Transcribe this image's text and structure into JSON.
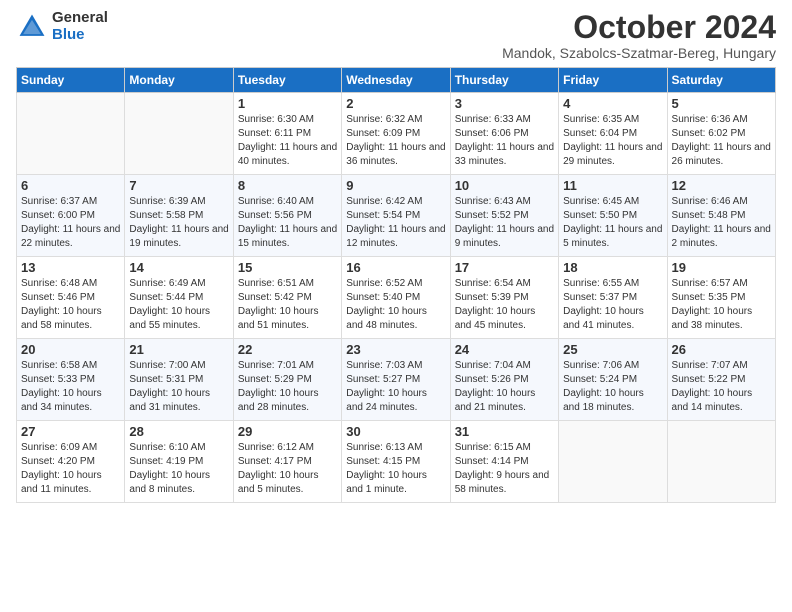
{
  "logo": {
    "general": "General",
    "blue": "Blue"
  },
  "title": "October 2024",
  "location": "Mandok, Szabolcs-Szatmar-Bereg, Hungary",
  "weekdays": [
    "Sunday",
    "Monday",
    "Tuesday",
    "Wednesday",
    "Thursday",
    "Friday",
    "Saturday"
  ],
  "weeks": [
    [
      {
        "day": "",
        "sunrise": "",
        "sunset": "",
        "daylight": "",
        "empty": true
      },
      {
        "day": "",
        "sunrise": "",
        "sunset": "",
        "daylight": "",
        "empty": true
      },
      {
        "day": "1",
        "sunrise": "Sunrise: 6:30 AM",
        "sunset": "Sunset: 6:11 PM",
        "daylight": "Daylight: 11 hours and 40 minutes."
      },
      {
        "day": "2",
        "sunrise": "Sunrise: 6:32 AM",
        "sunset": "Sunset: 6:09 PM",
        "daylight": "Daylight: 11 hours and 36 minutes."
      },
      {
        "day": "3",
        "sunrise": "Sunrise: 6:33 AM",
        "sunset": "Sunset: 6:06 PM",
        "daylight": "Daylight: 11 hours and 33 minutes."
      },
      {
        "day": "4",
        "sunrise": "Sunrise: 6:35 AM",
        "sunset": "Sunset: 6:04 PM",
        "daylight": "Daylight: 11 hours and 29 minutes."
      },
      {
        "day": "5",
        "sunrise": "Sunrise: 6:36 AM",
        "sunset": "Sunset: 6:02 PM",
        "daylight": "Daylight: 11 hours and 26 minutes."
      }
    ],
    [
      {
        "day": "6",
        "sunrise": "Sunrise: 6:37 AM",
        "sunset": "Sunset: 6:00 PM",
        "daylight": "Daylight: 11 hours and 22 minutes."
      },
      {
        "day": "7",
        "sunrise": "Sunrise: 6:39 AM",
        "sunset": "Sunset: 5:58 PM",
        "daylight": "Daylight: 11 hours and 19 minutes."
      },
      {
        "day": "8",
        "sunrise": "Sunrise: 6:40 AM",
        "sunset": "Sunset: 5:56 PM",
        "daylight": "Daylight: 11 hours and 15 minutes."
      },
      {
        "day": "9",
        "sunrise": "Sunrise: 6:42 AM",
        "sunset": "Sunset: 5:54 PM",
        "daylight": "Daylight: 11 hours and 12 minutes."
      },
      {
        "day": "10",
        "sunrise": "Sunrise: 6:43 AM",
        "sunset": "Sunset: 5:52 PM",
        "daylight": "Daylight: 11 hours and 9 minutes."
      },
      {
        "day": "11",
        "sunrise": "Sunrise: 6:45 AM",
        "sunset": "Sunset: 5:50 PM",
        "daylight": "Daylight: 11 hours and 5 minutes."
      },
      {
        "day": "12",
        "sunrise": "Sunrise: 6:46 AM",
        "sunset": "Sunset: 5:48 PM",
        "daylight": "Daylight: 11 hours and 2 minutes."
      }
    ],
    [
      {
        "day": "13",
        "sunrise": "Sunrise: 6:48 AM",
        "sunset": "Sunset: 5:46 PM",
        "daylight": "Daylight: 10 hours and 58 minutes."
      },
      {
        "day": "14",
        "sunrise": "Sunrise: 6:49 AM",
        "sunset": "Sunset: 5:44 PM",
        "daylight": "Daylight: 10 hours and 55 minutes."
      },
      {
        "day": "15",
        "sunrise": "Sunrise: 6:51 AM",
        "sunset": "Sunset: 5:42 PM",
        "daylight": "Daylight: 10 hours and 51 minutes."
      },
      {
        "day": "16",
        "sunrise": "Sunrise: 6:52 AM",
        "sunset": "Sunset: 5:40 PM",
        "daylight": "Daylight: 10 hours and 48 minutes."
      },
      {
        "day": "17",
        "sunrise": "Sunrise: 6:54 AM",
        "sunset": "Sunset: 5:39 PM",
        "daylight": "Daylight: 10 hours and 45 minutes."
      },
      {
        "day": "18",
        "sunrise": "Sunrise: 6:55 AM",
        "sunset": "Sunset: 5:37 PM",
        "daylight": "Daylight: 10 hours and 41 minutes."
      },
      {
        "day": "19",
        "sunrise": "Sunrise: 6:57 AM",
        "sunset": "Sunset: 5:35 PM",
        "daylight": "Daylight: 10 hours and 38 minutes."
      }
    ],
    [
      {
        "day": "20",
        "sunrise": "Sunrise: 6:58 AM",
        "sunset": "Sunset: 5:33 PM",
        "daylight": "Daylight: 10 hours and 34 minutes."
      },
      {
        "day": "21",
        "sunrise": "Sunrise: 7:00 AM",
        "sunset": "Sunset: 5:31 PM",
        "daylight": "Daylight: 10 hours and 31 minutes."
      },
      {
        "day": "22",
        "sunrise": "Sunrise: 7:01 AM",
        "sunset": "Sunset: 5:29 PM",
        "daylight": "Daylight: 10 hours and 28 minutes."
      },
      {
        "day": "23",
        "sunrise": "Sunrise: 7:03 AM",
        "sunset": "Sunset: 5:27 PM",
        "daylight": "Daylight: 10 hours and 24 minutes."
      },
      {
        "day": "24",
        "sunrise": "Sunrise: 7:04 AM",
        "sunset": "Sunset: 5:26 PM",
        "daylight": "Daylight: 10 hours and 21 minutes."
      },
      {
        "day": "25",
        "sunrise": "Sunrise: 7:06 AM",
        "sunset": "Sunset: 5:24 PM",
        "daylight": "Daylight: 10 hours and 18 minutes."
      },
      {
        "day": "26",
        "sunrise": "Sunrise: 7:07 AM",
        "sunset": "Sunset: 5:22 PM",
        "daylight": "Daylight: 10 hours and 14 minutes."
      }
    ],
    [
      {
        "day": "27",
        "sunrise": "Sunrise: 6:09 AM",
        "sunset": "Sunset: 4:20 PM",
        "daylight": "Daylight: 10 hours and 11 minutes."
      },
      {
        "day": "28",
        "sunrise": "Sunrise: 6:10 AM",
        "sunset": "Sunset: 4:19 PM",
        "daylight": "Daylight: 10 hours and 8 minutes."
      },
      {
        "day": "29",
        "sunrise": "Sunrise: 6:12 AM",
        "sunset": "Sunset: 4:17 PM",
        "daylight": "Daylight: 10 hours and 5 minutes."
      },
      {
        "day": "30",
        "sunrise": "Sunrise: 6:13 AM",
        "sunset": "Sunset: 4:15 PM",
        "daylight": "Daylight: 10 hours and 1 minute."
      },
      {
        "day": "31",
        "sunrise": "Sunrise: 6:15 AM",
        "sunset": "Sunset: 4:14 PM",
        "daylight": "Daylight: 9 hours and 58 minutes."
      },
      {
        "day": "",
        "sunrise": "",
        "sunset": "",
        "daylight": "",
        "empty": true
      },
      {
        "day": "",
        "sunrise": "",
        "sunset": "",
        "daylight": "",
        "empty": true
      }
    ]
  ]
}
